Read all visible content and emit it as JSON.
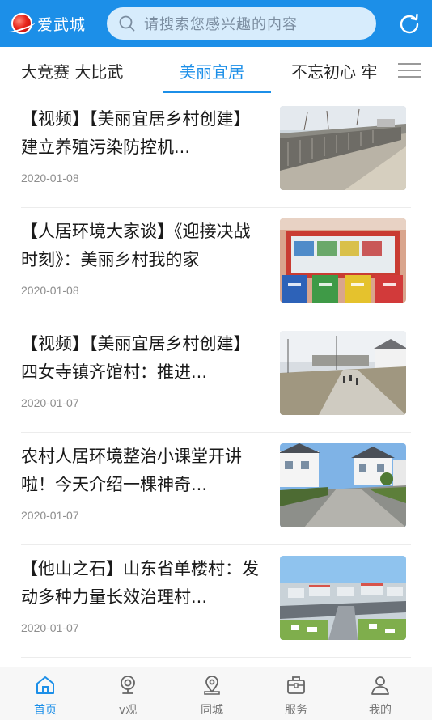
{
  "header": {
    "app_name": "爱武城",
    "search_placeholder": "请搜索您感兴趣的内容",
    "accent_color": "#1c8fe8"
  },
  "tabs": [
    {
      "label": "大竞赛 大比武",
      "active": false
    },
    {
      "label": "美丽宜居",
      "active": true
    },
    {
      "label": "不忘初心 牢",
      "active": false
    }
  ],
  "articles": [
    {
      "title": "【视频】【美丽宜居乡村创建】建立养殖污染防控机...",
      "date": "2020-01-08",
      "thumb": "wall-road"
    },
    {
      "title": "【人居环境大家谈】《迎接决战时刻》：美丽乡村我的家",
      "date": "2020-01-08",
      "thumb": "trash-bins"
    },
    {
      "title": "【视频】【美丽宜居乡村创建】四女寺镇齐馆村：推进...",
      "date": "2020-01-07",
      "thumb": "village-road"
    },
    {
      "title": "农村人居环境整治小课堂开讲啦！今天介绍一棵神奇...",
      "date": "2020-01-07",
      "thumb": "village-houses"
    },
    {
      "title": "【他山之石】山东省单楼村：发动多种力量长效治理村...",
      "date": "2020-01-07",
      "thumb": "aerial-town"
    }
  ],
  "bottom_nav": [
    {
      "label": "首页",
      "icon": "home-icon",
      "active": true
    },
    {
      "label": "v观",
      "icon": "webcam-icon",
      "active": false
    },
    {
      "label": "同城",
      "icon": "location-icon",
      "active": false
    },
    {
      "label": "服务",
      "icon": "briefcase-icon",
      "active": false
    },
    {
      "label": "我的",
      "icon": "user-icon",
      "active": false
    }
  ]
}
